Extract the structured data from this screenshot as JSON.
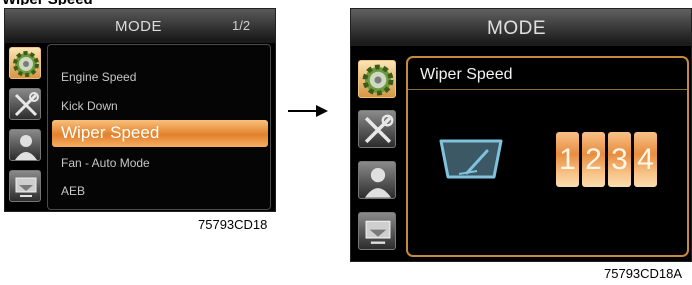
{
  "left_screen": {
    "title": "MODE",
    "page_indicator": "1/2",
    "menu_items": [
      {
        "label": "Engine  Speed",
        "selected": false
      },
      {
        "label": "Kick Down",
        "selected": false
      },
      {
        "label": "Wiper Speed",
        "selected": true
      },
      {
        "label": "Fan - Auto Mode",
        "selected": false
      },
      {
        "label": "AEB",
        "selected": false
      }
    ],
    "side_icons": [
      "gear-icon",
      "tools-icon",
      "user-icon",
      "display-icon"
    ],
    "caption": "75793CD18"
  },
  "right_screen": {
    "title": "MODE",
    "panel_title": "Wiper Speed",
    "speed_options": [
      "1",
      "2",
      "3",
      "4"
    ],
    "side_icons": [
      "gear-icon",
      "tools-icon",
      "user-icon",
      "display-icon"
    ],
    "caption": "75793CD18A"
  },
  "icons": {
    "transition": "right-arrow-icon",
    "wiper": "wiper-icon"
  },
  "colors": {
    "accent_orange": "#e2812c",
    "panel_border": "#c58a3e",
    "wiper_icon": "#7fc3dd",
    "screen_background": "#000000"
  }
}
